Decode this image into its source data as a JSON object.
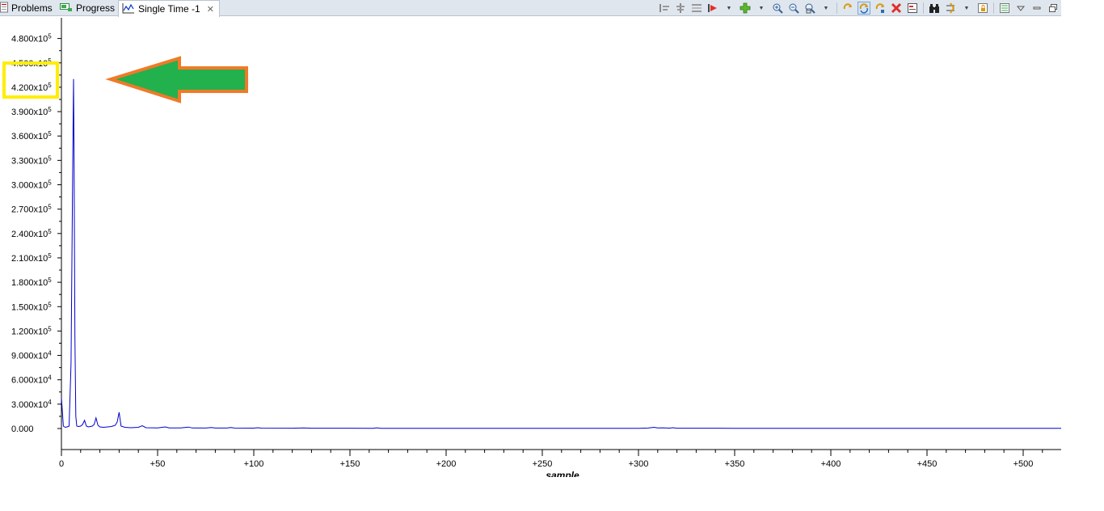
{
  "tabs": [
    {
      "label": "Problems",
      "icon": "problems-icon"
    },
    {
      "label": "Progress",
      "icon": "progress-icon"
    },
    {
      "label": "Single Time -1",
      "icon": "graph-icon",
      "active": true,
      "close": "✕"
    }
  ],
  "toolbar": {
    "buttons": [
      "align-left-icon",
      "align-center-icon",
      "align-right-icon",
      "marker-icon",
      "add-icon",
      "zoom-in-icon",
      "zoom-out-icon",
      "zoom-fit-icon",
      "refresh-icon",
      "auto-refresh-icon",
      "refresh-continuous-icon",
      "remove-icon",
      "export-icon",
      "binoculars-icon",
      "settings-icon",
      "lock-icon",
      "properties-icon",
      "view-menu-icon",
      "minimize-icon",
      "maximize-icon"
    ]
  },
  "annotation": {
    "highlight_color": "#ffee00",
    "arrow_fill": "#22b14c",
    "arrow_stroke": "#f07a28"
  },
  "chart_data": {
    "type": "line",
    "series_color": "#0000cc",
    "xlabel": "sample",
    "xlim": [
      0,
      520
    ],
    "ylim": [
      -10000,
      500000
    ],
    "y_ticks": [
      {
        "value": 480000,
        "mant": "4.800x10",
        "exp": "5"
      },
      {
        "value": 450000,
        "mant": "4.500x10",
        "exp": "5"
      },
      {
        "value": 420000,
        "mant": "4.200x10",
        "exp": "5"
      },
      {
        "value": 390000,
        "mant": "3.900x10",
        "exp": "5"
      },
      {
        "value": 360000,
        "mant": "3.600x10",
        "exp": "5"
      },
      {
        "value": 330000,
        "mant": "3.300x10",
        "exp": "5"
      },
      {
        "value": 300000,
        "mant": "3.000x10",
        "exp": "5"
      },
      {
        "value": 270000,
        "mant": "2.700x10",
        "exp": "5"
      },
      {
        "value": 240000,
        "mant": "2.400x10",
        "exp": "5"
      },
      {
        "value": 210000,
        "mant": "2.100x10",
        "exp": "5"
      },
      {
        "value": 180000,
        "mant": "1.800x10",
        "exp": "5"
      },
      {
        "value": 150000,
        "mant": "1.500x10",
        "exp": "5"
      },
      {
        "value": 120000,
        "mant": "1.200x10",
        "exp": "5"
      },
      {
        "value": 90000,
        "mant": "9.000x10",
        "exp": "4"
      },
      {
        "value": 60000,
        "mant": "6.000x10",
        "exp": "4"
      },
      {
        "value": 30000,
        "mant": "3.000x10",
        "exp": "4"
      },
      {
        "value": 0,
        "mant": "0.000",
        "exp": ""
      }
    ],
    "x_ticks": [
      {
        "value": 0,
        "label": "0"
      },
      {
        "value": 50,
        "label": "+50"
      },
      {
        "value": 100,
        "label": "+100"
      },
      {
        "value": 150,
        "label": "+150"
      },
      {
        "value": 200,
        "label": "+200"
      },
      {
        "value": 250,
        "label": "+250"
      },
      {
        "value": 300,
        "label": "+300"
      },
      {
        "value": 350,
        "label": "+350"
      },
      {
        "value": 400,
        "label": "+400"
      },
      {
        "value": 450,
        "label": "+450"
      },
      {
        "value": 500,
        "label": "+500"
      }
    ],
    "points": [
      [
        0,
        38000
      ],
      [
        1,
        3000
      ],
      [
        2,
        1500
      ],
      [
        3,
        2000
      ],
      [
        4,
        3000
      ],
      [
        5,
        80000
      ],
      [
        5.5,
        220000
      ],
      [
        6,
        360000
      ],
      [
        6.3,
        430000
      ],
      [
        6.6,
        325000
      ],
      [
        7,
        112000
      ],
      [
        7.5,
        15000
      ],
      [
        8,
        3000
      ],
      [
        9,
        2500
      ],
      [
        10,
        3000
      ],
      [
        11,
        5000
      ],
      [
        12,
        10000
      ],
      [
        13,
        3000
      ],
      [
        14,
        2000
      ],
      [
        15,
        2500
      ],
      [
        16,
        3000
      ],
      [
        17,
        5000
      ],
      [
        18,
        13000
      ],
      [
        19,
        4000
      ],
      [
        20,
        2000
      ],
      [
        22,
        1500
      ],
      [
        24,
        2000
      ],
      [
        26,
        2500
      ],
      [
        28,
        4000
      ],
      [
        29,
        8000
      ],
      [
        30,
        20000
      ],
      [
        31,
        3000
      ],
      [
        33,
        1500
      ],
      [
        36,
        1000
      ],
      [
        40,
        1500
      ],
      [
        42,
        3500
      ],
      [
        44,
        1000
      ],
      [
        50,
        800
      ],
      [
        54,
        2000
      ],
      [
        56,
        800
      ],
      [
        62,
        700
      ],
      [
        66,
        1800
      ],
      [
        68,
        700
      ],
      [
        75,
        600
      ],
      [
        78,
        1200
      ],
      [
        80,
        600
      ],
      [
        86,
        600
      ],
      [
        88,
        1200
      ],
      [
        90,
        600
      ],
      [
        100,
        500
      ],
      [
        102,
        1000
      ],
      [
        104,
        500
      ],
      [
        120,
        400
      ],
      [
        126,
        800
      ],
      [
        130,
        400
      ],
      [
        150,
        400
      ],
      [
        162,
        300
      ],
      [
        164,
        900
      ],
      [
        166,
        300
      ],
      [
        200,
        250
      ],
      [
        250,
        200
      ],
      [
        300,
        300
      ],
      [
        305,
        600
      ],
      [
        308,
        1500
      ],
      [
        310,
        700
      ],
      [
        313,
        900
      ],
      [
        316,
        500
      ],
      [
        318,
        1000
      ],
      [
        320,
        400
      ],
      [
        350,
        250
      ],
      [
        400,
        200
      ],
      [
        450,
        200
      ],
      [
        500,
        200
      ],
      [
        520,
        200
      ]
    ]
  }
}
